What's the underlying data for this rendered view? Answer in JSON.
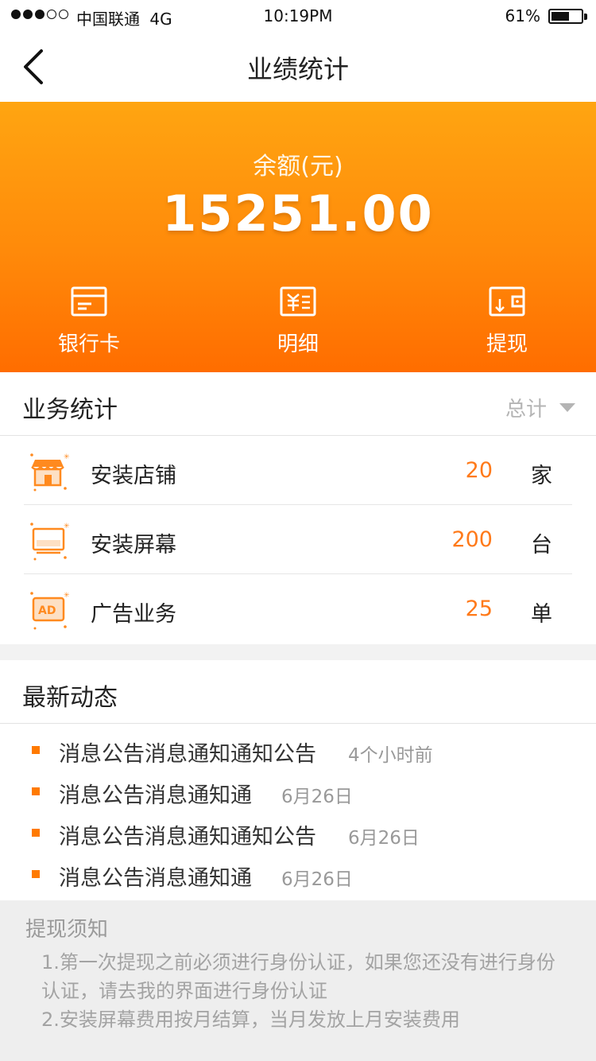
{
  "status_bar": {
    "carrier": "中国联通",
    "network": "4G",
    "time": "10:19PM",
    "battery": "61%",
    "battery_level": 0.61,
    "signal_strength": 3,
    "signal_max": 5
  },
  "nav": {
    "title": "业绩统计",
    "back_icon": "chevron-left-icon"
  },
  "balance": {
    "label": "余额(元)",
    "value": "15251.00"
  },
  "actions": [
    {
      "label": "银行卡",
      "icon": "bank-card-icon"
    },
    {
      "label": "明细",
      "icon": "detail-list-icon"
    },
    {
      "label": "提现",
      "icon": "wallet-withdraw-icon"
    }
  ],
  "business": {
    "title": "业务统计",
    "filter": "总计",
    "rows": [
      {
        "label": "安装店铺",
        "count": "20",
        "unit": "家",
        "icon": "store-icon"
      },
      {
        "label": "安装屏幕",
        "count": "200",
        "unit": "台",
        "icon": "screen-icon"
      },
      {
        "label": "广告业务",
        "count": "25",
        "unit": "单",
        "icon": "ad-icon"
      }
    ]
  },
  "news": {
    "title": "最新动态",
    "items": [
      {
        "text": "消息公告消息通知通知公告",
        "time": "4个小时前"
      },
      {
        "text": "消息公告消息通知通",
        "time": "6月26日"
      },
      {
        "text": "消息公告消息通知通知公告",
        "time": "6月26日"
      },
      {
        "text": "消息公告消息通知通",
        "time": "6月26日"
      }
    ]
  },
  "notice": {
    "title": "提现须知",
    "line1": "1.第一次提现之前必须进行身份认证，如果您还没有进行身份认证，请去我的界面进行身份认证",
    "line2": "2.安装屏幕费用按月结算，当月发放上月安装费用"
  },
  "colors": {
    "accent": "#ff7a1a",
    "hero_top": "#ffa511",
    "hero_bottom": "#ff6d00"
  }
}
